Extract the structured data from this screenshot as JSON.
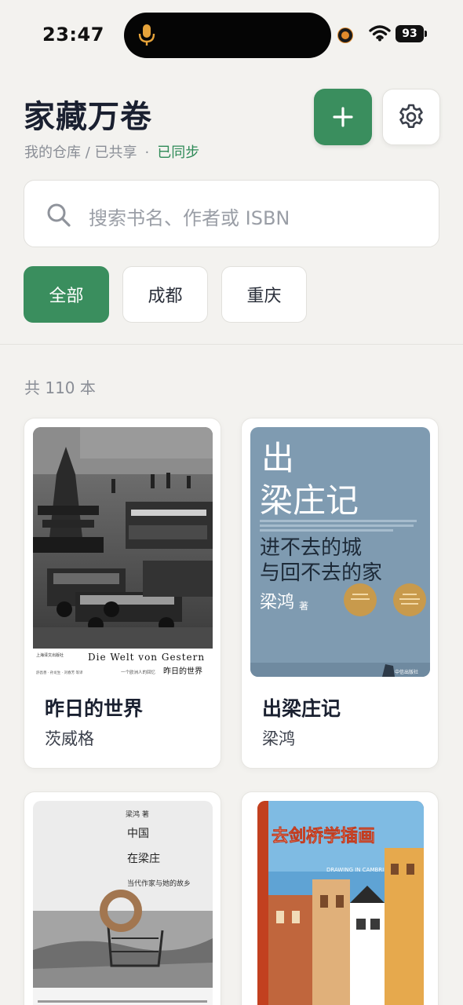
{
  "status_bar": {
    "time": "23:47",
    "battery": "93",
    "icons": [
      "mic-icon",
      "recording-dot",
      "wifi-icon",
      "battery-icon"
    ]
  },
  "header": {
    "title": "家藏万卷",
    "breadcrumb": "我的仓库 / 已共享",
    "separator": "·",
    "sync_status": "已同步",
    "add_icon": "plus-icon",
    "settings_icon": "gear-icon"
  },
  "search": {
    "placeholder": "搜索书名、作者或 ISBN",
    "icon": "search-icon"
  },
  "filters": {
    "chips": [
      "全部",
      "成都",
      "重庆"
    ],
    "selected": "全部"
  },
  "count_label": "共 110 本",
  "colors": {
    "accent": "#3a8e5e",
    "background": "#f3f2ef",
    "sync_text": "#2e8a57"
  },
  "books": [
    {
      "title": "昨日的世界",
      "author": "茨威格",
      "cover": {
        "publisher": "上海译文出版社",
        "german_title": "Die Welt von Gestern",
        "subtitle": "一个欧洲人的回忆",
        "title": "昨日的世界",
        "credit": "舒昌善 · 孙龙生 · 刘春芳 等译"
      }
    },
    {
      "title": "出梁庄记",
      "author": "梁鸿",
      "cover": {
        "title_line1": "出",
        "title_line2": "梁庄记",
        "tagline1": "进不去的城",
        "tagline2": "与回不去的家",
        "author": "梁鸿",
        "author_suffix": "著",
        "publisher": "中信出版社"
      }
    },
    {
      "title": "",
      "author": "",
      "cover": {
        "author": "梁鸿 著",
        "line1": "中国",
        "line2": "在梁庄",
        "subtitle": "当代作家与她的故乡"
      }
    },
    {
      "title": "",
      "author": "",
      "cover": {
        "title": "去剑桥学插画",
        "english": "DRAWING IN CAMBRIDGE"
      }
    }
  ]
}
